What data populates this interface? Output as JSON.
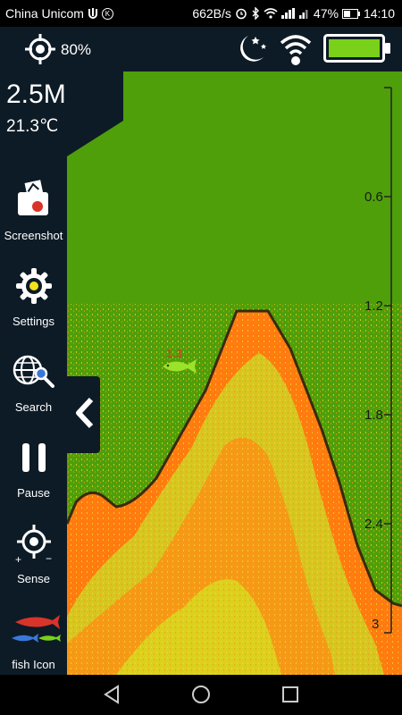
{
  "status_bar": {
    "carrier": "China Unicom",
    "net_speed": "662B/s",
    "battery_percent": "47%",
    "time": "14:10"
  },
  "app_bar": {
    "sonar_level": "80%",
    "icons": [
      "sonar-target-icon",
      "night-mode-icon",
      "wifi-icon",
      "battery-icon"
    ],
    "battery_color": "#7ad11a"
  },
  "readout": {
    "depth": "2.5M",
    "temperature": "21.3℃"
  },
  "sidebar": {
    "items": [
      {
        "label": "Screenshot",
        "icon": "screenshot-icon"
      },
      {
        "label": "Settings",
        "icon": "gear-icon"
      },
      {
        "label": "Search",
        "icon": "search-globe-icon"
      },
      {
        "label": "Pause",
        "icon": "pause-icon"
      },
      {
        "label": "Sense",
        "icon": "sense-crosshair-icon"
      },
      {
        "label": "fish Icon",
        "icon": "fish-icon"
      }
    ]
  },
  "fish_marker": {
    "depth_label": "1.3",
    "label_color": "#d8342a",
    "fish_color": "#9be22a"
  },
  "depth_scale": {
    "ticks": [
      "0.6",
      "1.2",
      "1.8",
      "2.4",
      "3"
    ]
  },
  "colors": {
    "water": "#4e9f0a",
    "bottom_strong": "#ff7b10",
    "bottom_weak": "#d9d61f",
    "panel": "#0d1b26"
  }
}
